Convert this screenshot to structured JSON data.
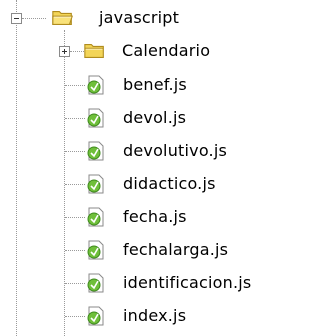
{
  "tree": {
    "root": {
      "label": "javascript",
      "icon": "folder-open-icon",
      "expander": "collapse"
    },
    "children": [
      {
        "label": "Calendario",
        "icon": "folder-icon",
        "expander": "expand"
      },
      {
        "label": "benef.js",
        "icon": "js-file-icon"
      },
      {
        "label": "devol.js",
        "icon": "js-file-icon"
      },
      {
        "label": "devolutivo.js",
        "icon": "js-file-icon"
      },
      {
        "label": "didactico.js",
        "icon": "js-file-icon"
      },
      {
        "label": "fecha.js",
        "icon": "js-file-icon"
      },
      {
        "label": "fechalarga.js",
        "icon": "js-file-icon"
      },
      {
        "label": "identificacion.js",
        "icon": "js-file-icon"
      },
      {
        "label": "index.js",
        "icon": "js-file-icon"
      }
    ]
  },
  "colors": {
    "folder_yellow": "#f3d558",
    "folder_outline": "#b08c1e",
    "js_green": "#6fbf3a",
    "connector": "#9a9a9a"
  }
}
